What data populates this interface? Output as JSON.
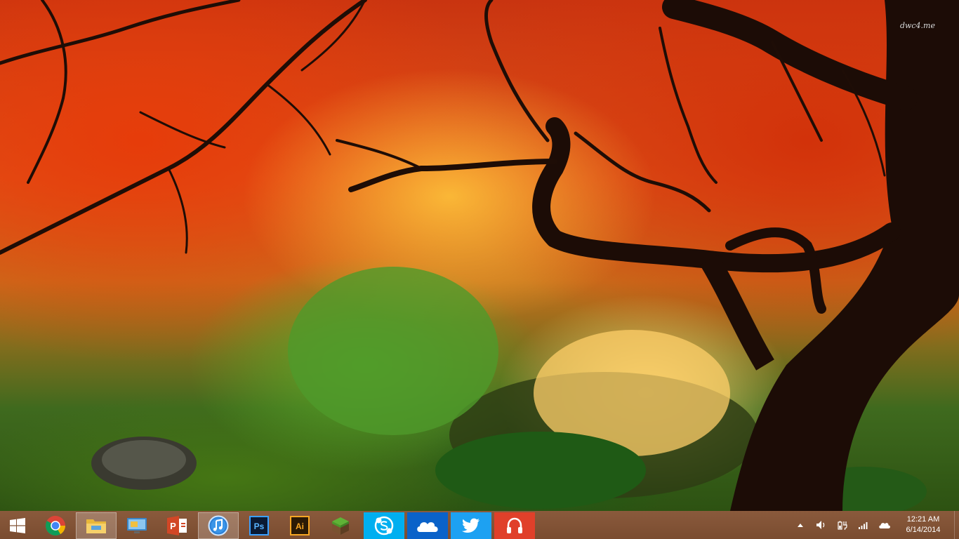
{
  "desktop": {
    "watermark": "dwc4.me"
  },
  "taskbar": {
    "pinned": [
      {
        "name": "start-button",
        "icon": "windows-logo-icon"
      },
      {
        "name": "chrome-button",
        "icon": "chrome-icon"
      },
      {
        "name": "file-explorer-button",
        "icon": "folder-icon",
        "active": true
      },
      {
        "name": "remote-desktop-button",
        "icon": "remote-desktop-icon"
      },
      {
        "name": "powerpoint-button",
        "icon": "powerpoint-icon",
        "label": "P"
      },
      {
        "name": "itunes-button",
        "icon": "itunes-icon",
        "active": true
      },
      {
        "name": "photoshop-button",
        "icon": "photoshop-icon",
        "label": "Ps"
      },
      {
        "name": "illustrator-button",
        "icon": "illustrator-icon",
        "label": "Ai"
      },
      {
        "name": "minecraft-button",
        "icon": "minecraft-icon"
      },
      {
        "name": "skype-button",
        "icon": "skype-icon",
        "color": "#00AFF0"
      },
      {
        "name": "onedrive-button",
        "icon": "onedrive-icon",
        "color": "#0a62c9"
      },
      {
        "name": "twitter-button",
        "icon": "twitter-icon",
        "color": "#1DA1F2"
      },
      {
        "name": "music-app-button",
        "icon": "headphones-icon",
        "color": "#e0402a"
      }
    ],
    "ppt_label": "P",
    "ps_label": "Ps",
    "ai_label": "Ai",
    "tray": {
      "icons": [
        "show-hidden-icons-icon",
        "volume-icon",
        "power-icon",
        "network-signal-icon",
        "onedrive-tray-icon"
      ],
      "time": "12:21 AM",
      "date": "6/14/2014"
    }
  }
}
